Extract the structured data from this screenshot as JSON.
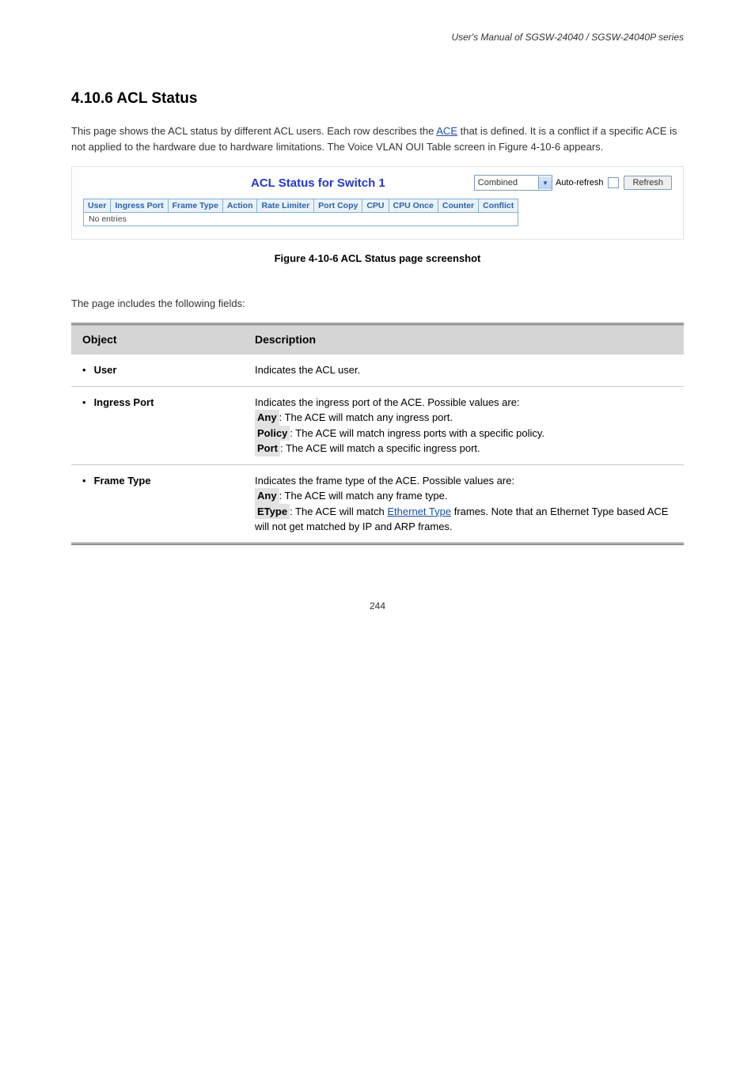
{
  "header_manual": "User's Manual of SGSW-24040 / SGSW-24040P series",
  "section_number": "4.10.6 ACL Status",
  "intro_p1": "This page shows the ACL status by different ACL users. Each row describes the ",
  "ace_link": "ACE",
  "intro_p2": " that is defined. It is a conflict if a specific ACE is not applied to the hardware due to hardware limitations. The Voice VLAN OUI Table screen in Figure 4-10-6 appears.",
  "figure": {
    "title": "ACL Status for Switch 1",
    "dropdown": "Combined",
    "auto_refresh_label": "Auto-refresh",
    "refresh_btn": "Refresh",
    "columns": [
      "User",
      "Ingress Port",
      "Frame Type",
      "Action",
      "Rate Limiter",
      "Port Copy",
      "CPU",
      "CPU Once",
      "Counter",
      "Conflict"
    ],
    "no_entries": "No entries"
  },
  "figure_caption": "Figure 4-10-6 ACL Status page screenshot",
  "table_intro": "The page includes the following fields:",
  "desc_header_obj": "Object",
  "desc_header_desc": "Description",
  "rows": {
    "user": {
      "label": "User",
      "desc": "Indicates the ACL user."
    },
    "ingress": {
      "label": "Ingress Port",
      "desc_intro": "Indicates the ingress port of the ACE. Possible values are:",
      "any_kw": "Any",
      "any_desc": ": The ACE will match any ingress port.",
      "policy_kw": "Policy",
      "policy_desc": ": The ACE will match ingress ports with a specific policy.",
      "port_kw": "Port",
      "port_desc": ": The ACE will match a specific ingress port."
    },
    "frame": {
      "label": "Frame Type",
      "desc_intro": "Indicates the frame type of the ACE. Possible values are:",
      "any_kw": "Any",
      "any_desc": ": The ACE will match any frame type.",
      "etype_kw": "EType",
      "etype_desc_a": ": The ACE will match ",
      "etype_link": "Ethernet Type",
      "etype_desc_b": " frames. Note that an Ethernet Type based ACE will not get matched by IP and ARP frames."
    }
  },
  "footer_page": "244"
}
